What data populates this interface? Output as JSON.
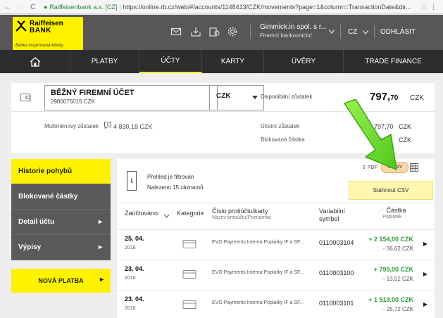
{
  "browser": {
    "nav_back": "←",
    "nav_forward": "→",
    "nav_reload": "C",
    "site_org": "Raiffeisenbank a.s. [CZ]",
    "url": "https://online.rb.cz/web/#/accounts/1148413/CZK/movements?page=1&column=TransactionDate&dir..."
  },
  "header": {
    "logo_name1": "Raiffeisen",
    "logo_name2": "BANK",
    "logo_tagline": "Banka inspirovaná klienty",
    "user_name": "Gimmick.in spol. s r...",
    "user_type": "Firemní bankovnictví",
    "language": "CZ",
    "logout": "ODHLÁSIT"
  },
  "nav": {
    "items": [
      "PLATBY",
      "ÚČTY",
      "KARTY",
      "ÚVĚRY",
      "TRADE FINANCE"
    ],
    "active": "ÚČTY"
  },
  "account": {
    "name": "BĚŽNÝ FIREMNÍ ÚČET",
    "number": "2900075015 CZK",
    "currency": "CZK",
    "available_label": "Disponibilní zůstatek",
    "available_whole": "797,",
    "available_decimal": "70",
    "available_currency": "CZK",
    "multicurrency_label": "Multiměnový zůstatek",
    "multicurrency_value": "4 830,18 CZK",
    "balance_label": "Účetní zůstatek",
    "balance_value": "797,70",
    "balance_currency": "CZK",
    "blocked_label": "Blokovaná částka",
    "blocked_value": "0,00",
    "blocked_currency": "CZK"
  },
  "sidebar": {
    "items": [
      {
        "label": "Historie pohybů",
        "active": true
      },
      {
        "label": "Blokované částky"
      },
      {
        "label": "Detail účtu"
      },
      {
        "label": "Výpisy"
      }
    ],
    "new_payment": "NOVÁ PLATBA"
  },
  "movements": {
    "filter_icon": "i",
    "filter_line1": "Přehled je filtrován",
    "filter_line2": "Nalezeno 15 záznamů.",
    "export_pdf": "PDF",
    "export_csv": "CSV",
    "tooltip": "Stáhnout CSV",
    "columns": {
      "date": "Zaúčtováno",
      "category": "Kategorie",
      "counter_account": "Číslo protiúčtu/karty",
      "counter_name": "Název protiúčtu/Poznámka",
      "vs_line1": "Variabilní",
      "vs_line2": "symbol",
      "amount": "Částka",
      "fee": "Poplatek"
    },
    "rows": [
      {
        "date": "25. 04.",
        "year": "2018",
        "desc": "EVO Payments Interna Poplatky IF a SF...",
        "vs": "0110003104",
        "amount": "+ 2 154,00 CZK",
        "fee": "- 36,62 CZK"
      },
      {
        "date": "23. 04.",
        "year": "2018",
        "desc": "EVO Payments Interna Poplatky IF a SF...",
        "vs": "0110003100",
        "amount": "+ 795,00 CZK",
        "fee": "- 13,52 CZK"
      },
      {
        "date": "23. 04.",
        "year": "2018",
        "desc": "EVO Payments Interna Poplatky IF a SF...",
        "vs": "0110003101",
        "amount": "+ 1 513,00 CZK",
        "fee": "- 25,72 CZK"
      }
    ]
  }
}
